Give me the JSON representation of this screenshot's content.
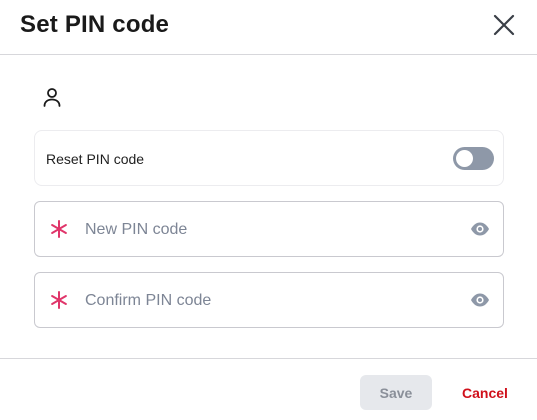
{
  "dialog": {
    "title": "Set PIN code",
    "close_icon": "close-icon",
    "user_icon": "user-icon"
  },
  "reset": {
    "label": "Reset PIN code",
    "enabled": false
  },
  "fields": {
    "new_pin": {
      "placeholder": "New PIN code",
      "value": "",
      "required": true,
      "icon": "eye-icon"
    },
    "confirm_pin": {
      "placeholder": "Confirm PIN code",
      "value": "",
      "required": true,
      "icon": "eye-icon"
    }
  },
  "footer": {
    "save_label": "Save",
    "cancel_label": "Cancel"
  },
  "colors": {
    "required_asterisk": "#e0356a",
    "cancel_text": "#d0101b",
    "toggle_off": "#8e98a8",
    "save_disabled_bg": "#e6e8ec"
  }
}
